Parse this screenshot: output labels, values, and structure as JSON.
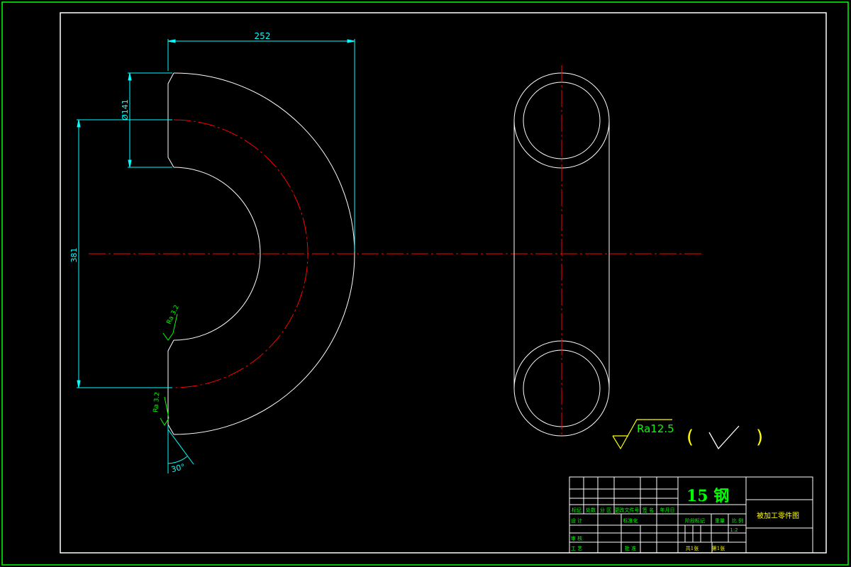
{
  "dimensions": {
    "width_label": "252",
    "diameter_label": "Ø141",
    "height_label": "381",
    "chamfer_angle": "30°"
  },
  "roughness": {
    "ra_inner": "Ra 3.2",
    "ra_outer": "Ra 3.2",
    "general": "Ra12.5",
    "paren_open": "(",
    "paren_close": ")"
  },
  "title_block": {
    "material": "15 钢",
    "drawing_title": "被加工零件图",
    "row_labels": {
      "mark": "标记",
      "count": "处数",
      "zone": "分 区",
      "change_doc": "更改文件号",
      "sign": "签 名",
      "date": "年月日",
      "design": "设 计",
      "standardize": "标准化",
      "review": "审 核",
      "process": "工 艺",
      "approve": "批 准"
    },
    "stage_mark": "阶段标记",
    "weight": "重量",
    "scale_label": "比 例",
    "scale_value": "1:2",
    "sheets_total": "共1张",
    "sheet_no": "第1张"
  },
  "colors": {
    "frame": "#00ff00",
    "outline": "#ffffff",
    "centerline": "#ff0000",
    "dimension": "#00ffff",
    "roughness_yellow": "#ffff00",
    "text_green": "#00ff00"
  }
}
